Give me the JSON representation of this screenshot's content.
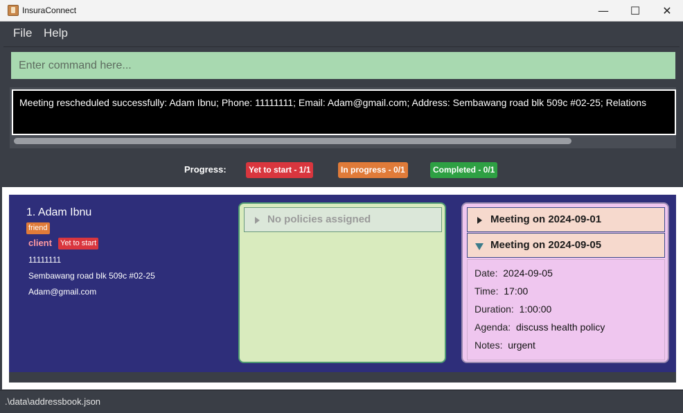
{
  "window": {
    "title": "InsuraConnect",
    "minimize": "—",
    "maximize": "☐",
    "close": "✕"
  },
  "menu": {
    "file": "File",
    "help": "Help"
  },
  "command": {
    "placeholder": "Enter command here..."
  },
  "result": {
    "text": "Meeting rescheduled successfully: Adam Ibnu; Phone: 11111111; Email: Adam@gmail.com; Address: Sembawang road blk 509c #02-25; Relations"
  },
  "progress": {
    "label": "Progress:",
    "yet_to_start": "Yet to start - 1/1",
    "in_progress": "In progress - 0/1",
    "completed": "Completed - 0/1",
    "colors": {
      "yet_to_start": "#d9363e",
      "in_progress": "#e07b39",
      "completed": "#2ea043"
    }
  },
  "person": {
    "index_name": "1.  Adam Ibnu",
    "tag": "friend",
    "relationship": "client",
    "status": "Yet to start",
    "phone": "11111111",
    "address": "Sembawang road blk 509c #02-25",
    "email": "Adam@gmail.com"
  },
  "policies": {
    "header": "No policies assigned"
  },
  "meetings": {
    "items": [
      {
        "title": "Meeting on 2024-09-01",
        "expanded": false
      },
      {
        "title": "Meeting on 2024-09-05",
        "expanded": true
      }
    ],
    "details": {
      "date_label": "Date:",
      "date": "2024-09-05",
      "time_label": "Time:",
      "time": "17:00",
      "duration_label": "Duration:",
      "duration": "1:00:00",
      "agenda_label": "Agenda:",
      "agenda": "discuss health policy",
      "notes_label": "Notes:",
      "notes": "urgent"
    }
  },
  "status_bar": {
    "path": ".\\data\\addressbook.json"
  }
}
